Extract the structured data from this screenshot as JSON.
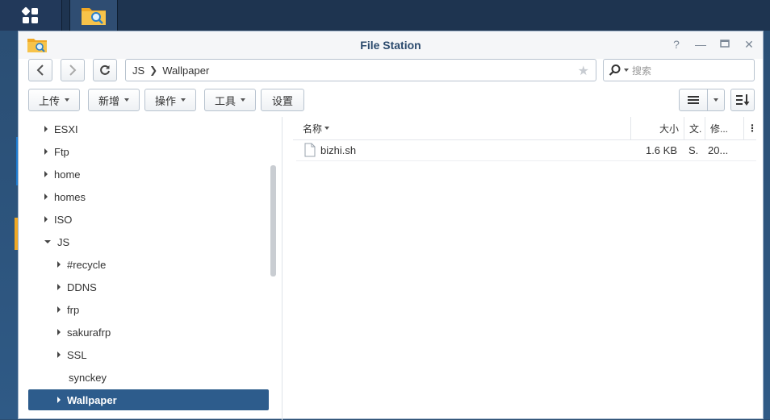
{
  "window": {
    "title": "File Station"
  },
  "path": {
    "crumbs": [
      "JS",
      "Wallpaper"
    ]
  },
  "search": {
    "placeholder": "搜索"
  },
  "toolbar": {
    "upload": "上传",
    "new": "新增",
    "action": "操作",
    "tools": "工具",
    "settings": "设置"
  },
  "tree": {
    "items": [
      {
        "label": "ESXI"
      },
      {
        "label": "Ftp"
      },
      {
        "label": "home"
      },
      {
        "label": "homes"
      },
      {
        "label": "ISO"
      },
      {
        "label": "JS"
      },
      {
        "label": "#recycle"
      },
      {
        "label": "DDNS"
      },
      {
        "label": "frp"
      },
      {
        "label": "sakurafrp"
      },
      {
        "label": "SSL"
      },
      {
        "label": "synckey"
      },
      {
        "label": "Wallpaper"
      }
    ]
  },
  "list": {
    "columns": {
      "name": "名称",
      "size": "大小",
      "type": "文.",
      "modified": "修..."
    },
    "rows": [
      {
        "name": "bizhi.sh",
        "size": "1.6 KB",
        "type": "S.",
        "modified": "20..."
      }
    ]
  },
  "colors": {
    "accent": "#2d5c8c",
    "title": "#2b4a6d",
    "taskbar": "#1e3450"
  }
}
